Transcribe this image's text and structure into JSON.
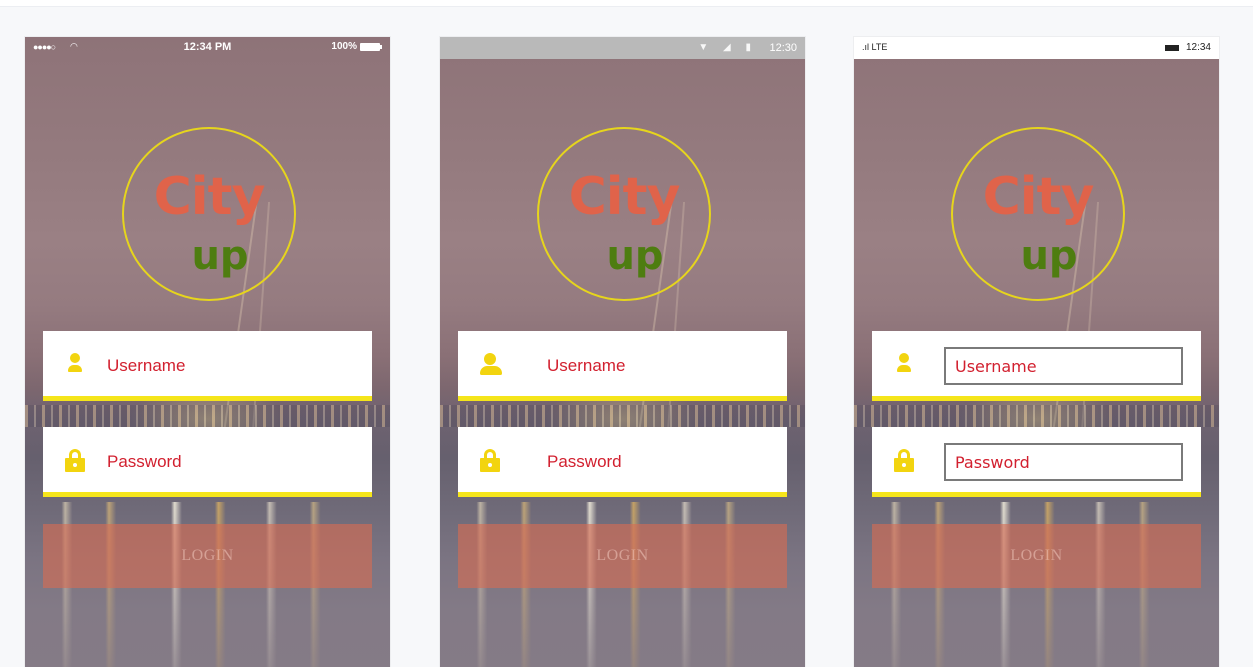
{
  "phones": [
    {
      "platform": "iOS",
      "status": {
        "time": "12:34 PM",
        "battery": "100%",
        "signal": "●●●●○",
        "wifi": "wifi-icon"
      },
      "logo": {
        "top": "City",
        "bottom": "up"
      },
      "username_label": "Username",
      "password_label": "Password",
      "login_label": "LOGIN"
    },
    {
      "platform": "Android",
      "status": {
        "time": "12:30",
        "icons": "▼ ◢ ▮"
      },
      "logo": {
        "top": "City",
        "bottom": "up"
      },
      "username_label": "Username",
      "password_label": "Password",
      "login_label": "LOGIN"
    },
    {
      "platform": "Windows Phone",
      "status": {
        "time": "12:34",
        "network": ".ıl LTE"
      },
      "logo": {
        "top": "City",
        "bottom": "up"
      },
      "username_label": "Username",
      "password_label": "Password",
      "login_label": "LOGIN"
    }
  ],
  "colors": {
    "accent_yellow": "#f5e51a",
    "label_red": "#d2202f",
    "logo_city": "#e0634a",
    "logo_up": "#4e7d10",
    "login_bg": "#d66c52"
  }
}
